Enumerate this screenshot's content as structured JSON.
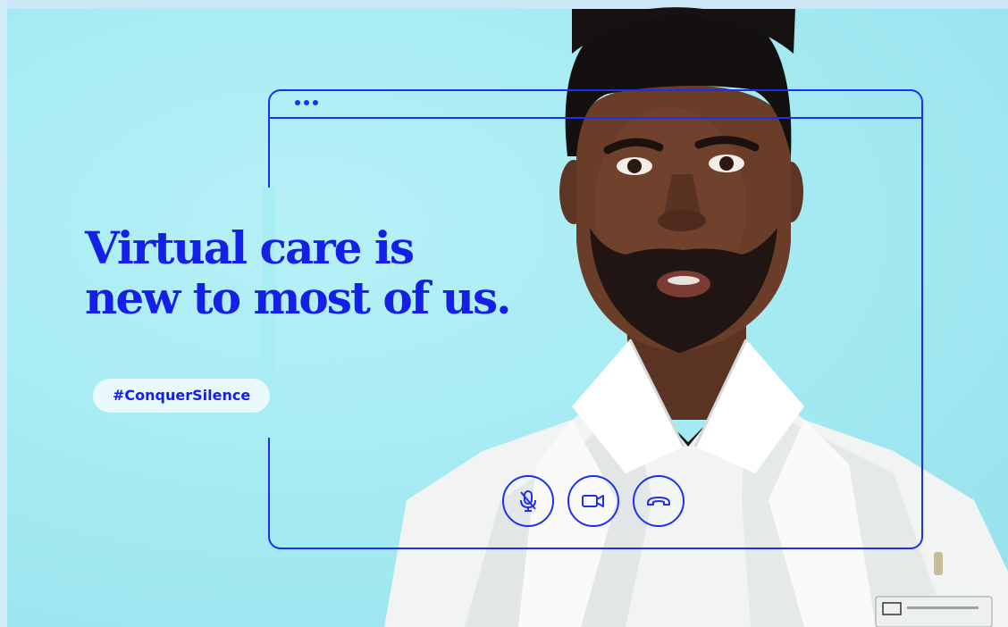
{
  "headline": {
    "line1": "Virtual care is",
    "line2": "new to most of us."
  },
  "hashtag": "#ConquerSilence",
  "controls": [
    {
      "icon": "mute-microphone-icon"
    },
    {
      "icon": "video-camera-icon"
    },
    {
      "icon": "hang-up-phone-icon"
    }
  ],
  "colors": {
    "accent": "#1d2ff0",
    "headline": "#1420e6",
    "background": "#a6ebf3"
  }
}
